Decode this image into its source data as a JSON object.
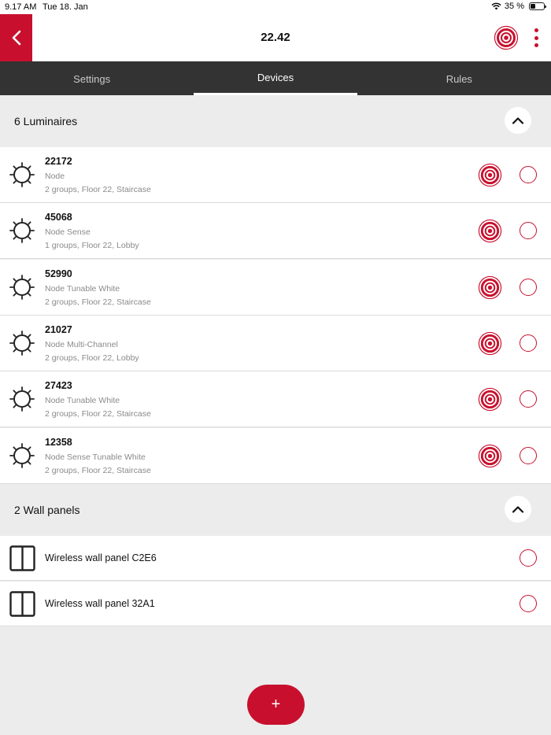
{
  "status_bar": {
    "time": "9.17 AM",
    "date": "Tue 18. Jan",
    "battery_text": "35 %",
    "battery_level": 0.35
  },
  "header": {
    "title": "22.42",
    "back_icon": "chevron-left-icon",
    "identify_icon": "target-icon",
    "more_icon": "more-vertical-icon"
  },
  "tabs": [
    {
      "label": "Settings",
      "active": false
    },
    {
      "label": "Devices",
      "active": true
    },
    {
      "label": "Rules",
      "active": false
    }
  ],
  "sections": {
    "luminaires": {
      "title": "6 Luminaires",
      "items": [
        {
          "id": "22172",
          "type": "Node",
          "groups": "2 groups, Floor 22, Staircase"
        },
        {
          "id": "45068",
          "type": "Node Sense",
          "groups": "1 groups, Floor 22, Lobby"
        },
        {
          "id": "52990",
          "type": "Node Tunable White",
          "groups": "2 groups, Floor 22, Staircase"
        },
        {
          "id": "21027",
          "type": "Node Multi-Channel",
          "groups": "2 groups, Floor 22, Lobby"
        },
        {
          "id": "27423",
          "type": "Node Tunable White",
          "groups": "2 groups, Floor 22, Staircase"
        },
        {
          "id": "12358",
          "type": "Node Sense Tunable White",
          "groups": "2 groups, Floor 22, Staircase"
        }
      ]
    },
    "wall_panels": {
      "title": "2 Wall panels",
      "items": [
        {
          "name": "Wireless wall panel C2E6"
        },
        {
          "name": "Wireless wall panel 32A1"
        }
      ]
    }
  },
  "fab": {
    "label": "+"
  },
  "colors": {
    "accent": "#c8102e",
    "tab_bar": "#333333",
    "section_bg": "#ececec"
  }
}
